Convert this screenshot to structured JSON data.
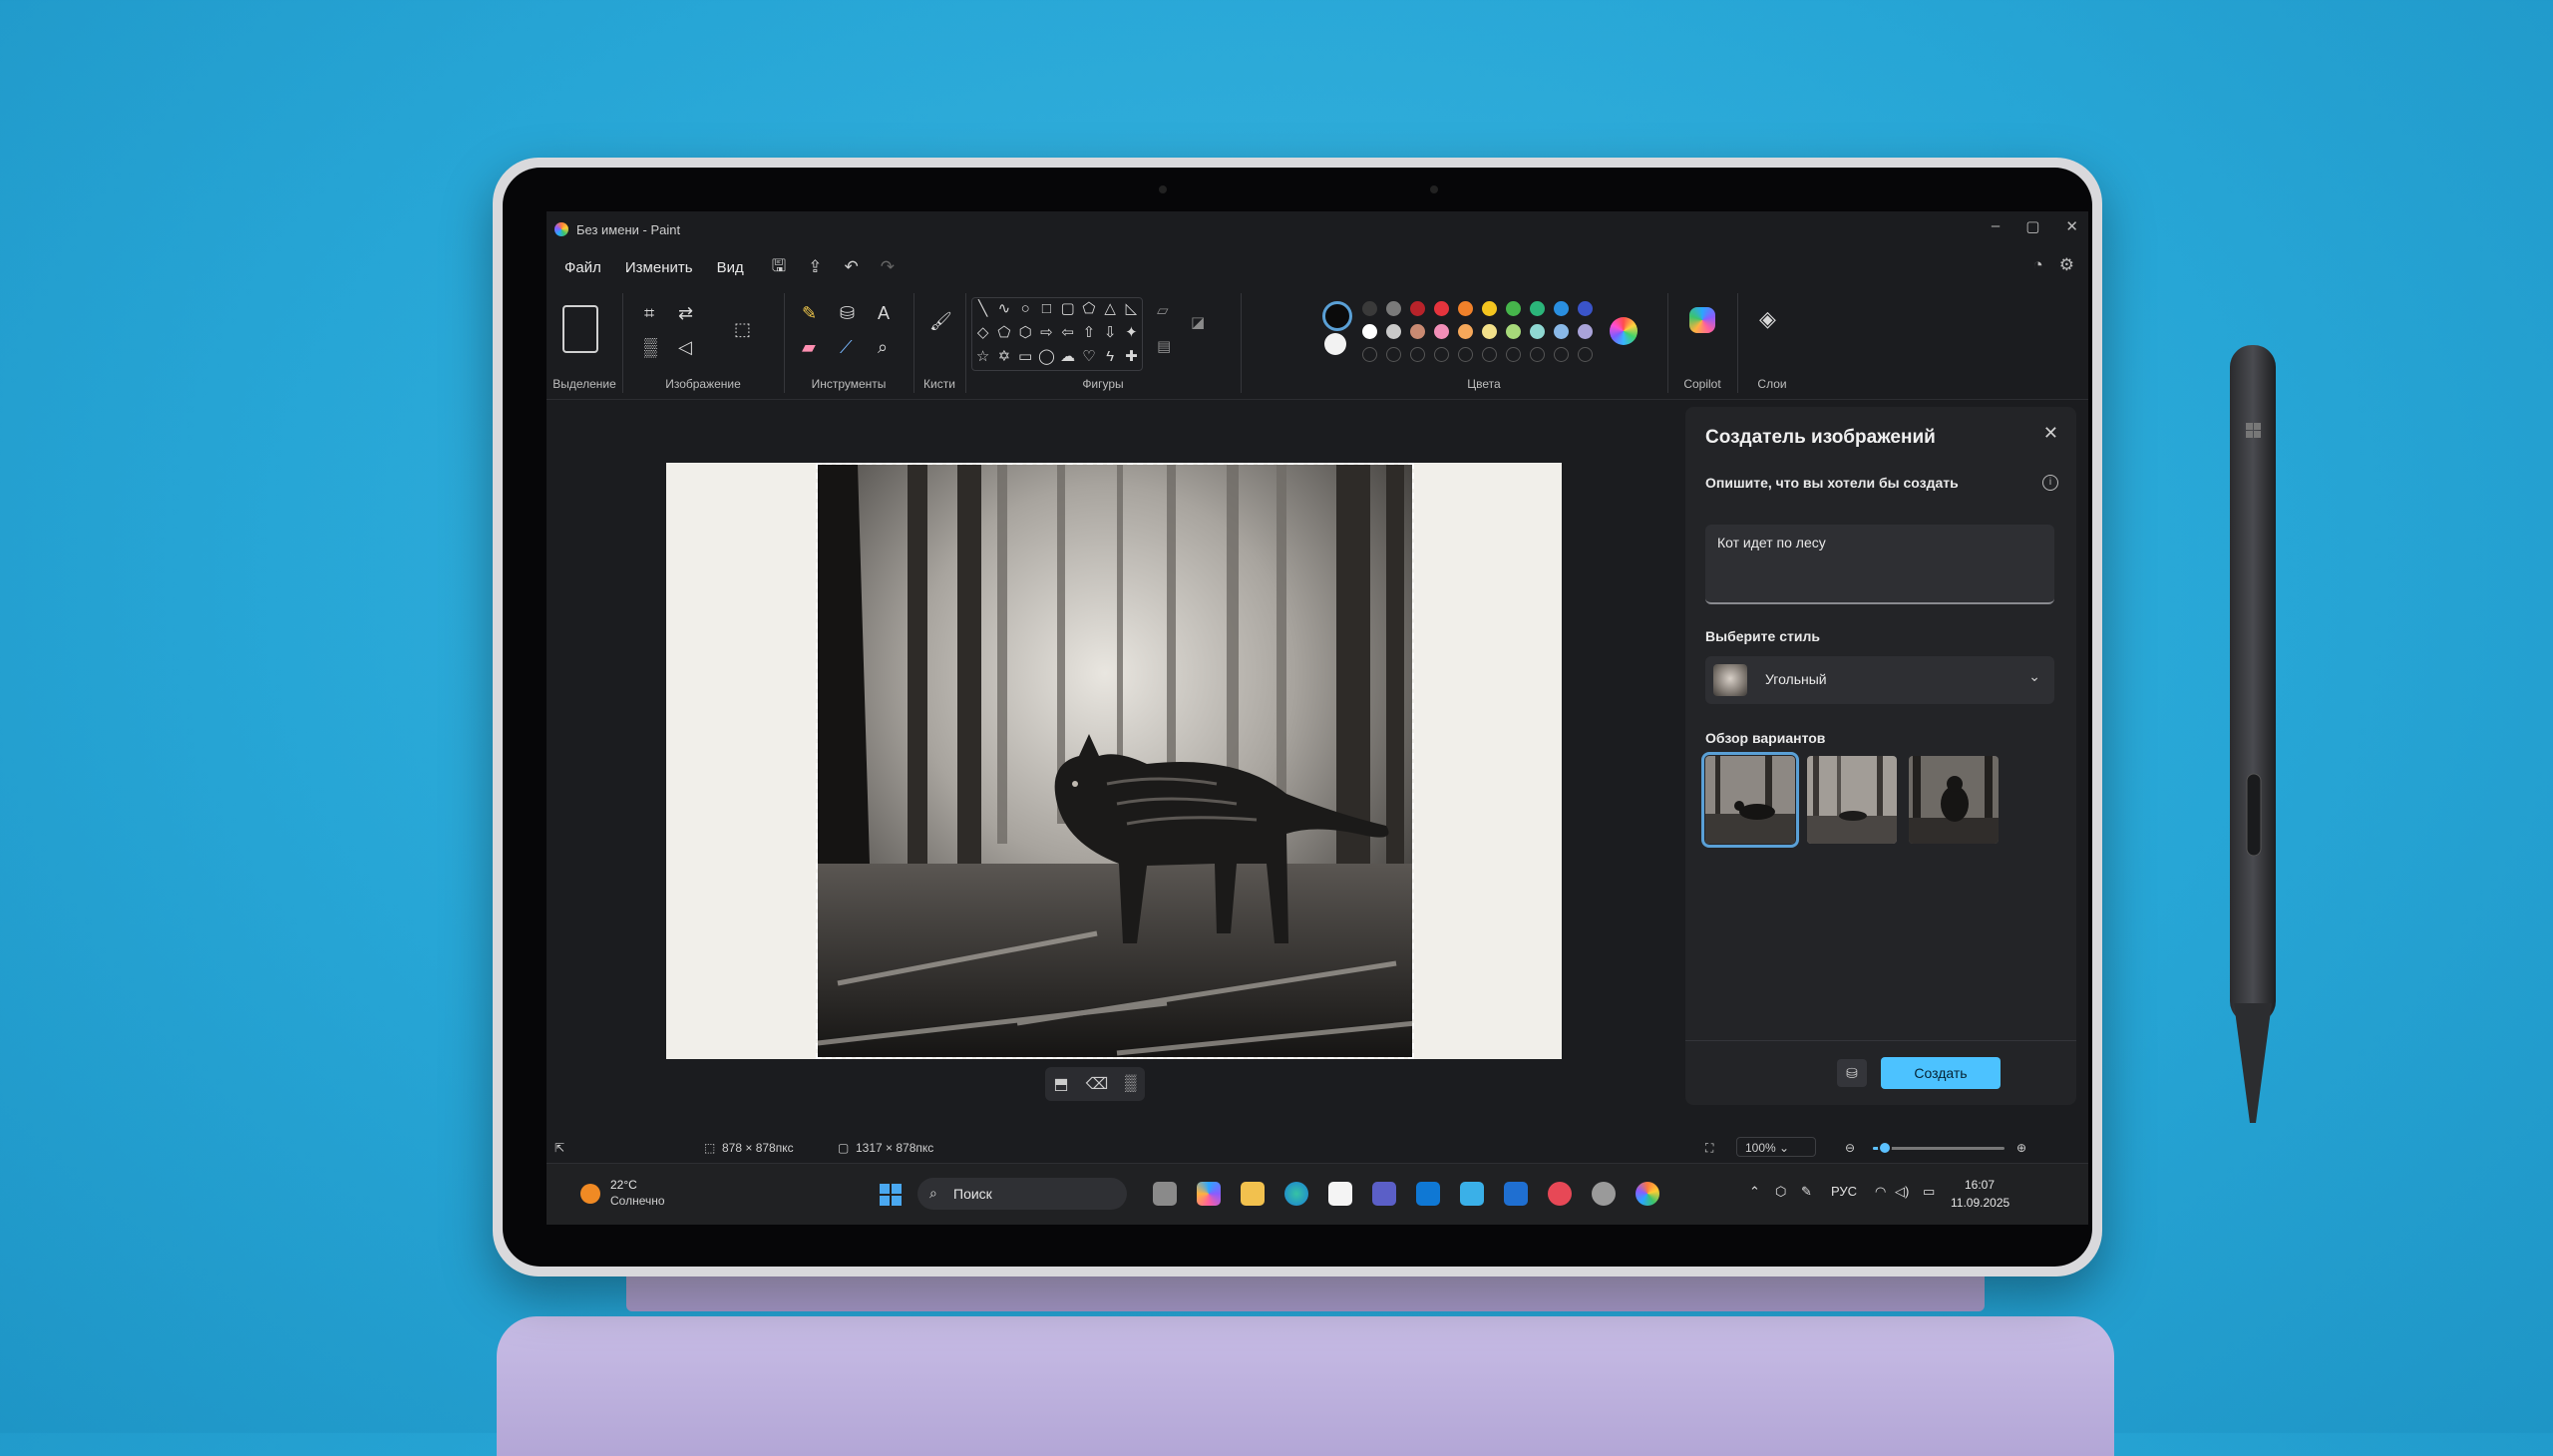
{
  "window": {
    "title": "Без имени - Paint",
    "controls": [
      "–",
      "▢",
      "✕"
    ]
  },
  "menu": {
    "items": [
      "Файл",
      "Изменить",
      "Вид"
    ]
  },
  "ribbon": {
    "groups": {
      "selection": "Выделение",
      "image": "Изображение",
      "tools": "Инструменты",
      "brushes": "Кисти",
      "shapes": "Фигуры",
      "colors": "Цвета",
      "copilot": "Copilot",
      "layers": "Слои"
    },
    "palette_row1": [
      "#3a3a3a",
      "#7a7a7a",
      "#b8232a",
      "#e5343d",
      "#f0812a",
      "#f4c51f",
      "#46b54b",
      "#2bb57a",
      "#2a8fe0",
      "#3a54c9",
      "#b04bd1"
    ],
    "palette_row2": [
      "#ffffff",
      "#c9c9c9",
      "#c98a72",
      "#f28fb8",
      "#f6a85a",
      "#f2e08a",
      "#a7d97a",
      "#8fd8d2",
      "#8ab9e8",
      "#a9a3d9",
      "#d3b2e6"
    ],
    "primary_color": "#000000",
    "secondary_color": "#ffffff"
  },
  "status": {
    "selection_size": "878 × 878пкс",
    "canvas_size": "1317 × 878пкс",
    "zoom": "100%",
    "zoom_level": 0.09
  },
  "panel": {
    "title": "Создатель изображений",
    "prompt_label": "Опишите, что вы хотели бы создать",
    "prompt_value": "Кот идет по лесу",
    "style_label": "Выберите стиль",
    "style_value": "Угольный",
    "variants_label": "Обзор вариантов",
    "create_button": "Создать"
  },
  "taskbar": {
    "weather_temp": "22°C",
    "weather_condition": "Солнечно",
    "search_placeholder": "Поиск",
    "language": "РУС",
    "time": "16:07",
    "date": "11.09.2025"
  }
}
